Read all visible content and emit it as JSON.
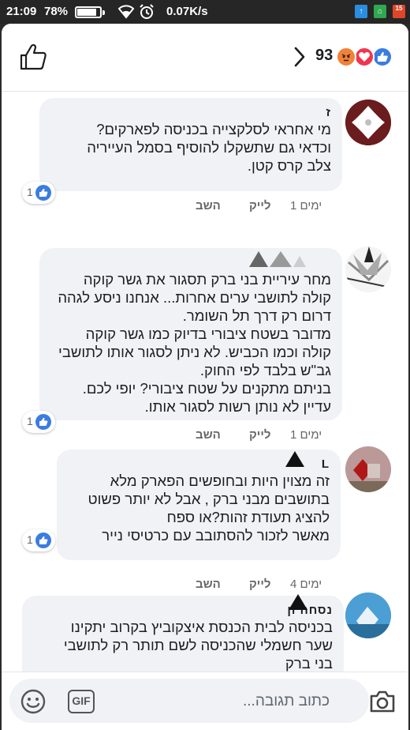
{
  "status_bar": {
    "time": "21:09",
    "battery_percent": "78%",
    "network_speed": "0.07K/s",
    "app_badge_3": "15"
  },
  "header": {
    "reaction_count": "93",
    "reactions": [
      "angry",
      "love",
      "like"
    ]
  },
  "comments": [
    {
      "author": "ז",
      "text": "מי אחראי לסלקצייה בכניסה לפארקים?\nוכדאי גם שתשקלו להוסיף בסמל העייריה\nצלב קרס קטן.",
      "like_count": "1",
      "time": "1 ימים",
      "like_label": "לייק",
      "reply_label": "השב"
    },
    {
      "author": "",
      "text": "מחר עיריית בני ברק תסגור את גשר קוקה\nקולה לתושבי ערים אחרות... אנחנו ניסע לגהה\nדרום רק דרך תל השומר.\nמדובר בשטח ציבורי בדיוק כמו גשר קוקה\nקולה וכמו הכביש. לא ניתן לסגור אותו לתושבי\nגב\"ש בלבד לפי החוק.\nבניתם מתקנים על שטח ציבורי? יופי לכם.\nעדיין לא נותן רשות לסגור אותו.",
      "like_count": "1",
      "time": "1 ימים",
      "like_label": "לייק",
      "reply_label": "השב"
    },
    {
      "author": "L",
      "text": "זה מצוין היות ובחופשים הפארק מלא\nבתושבים מבני ברק , אבל לא יותר פשוט\nלהציג תעודת זהות?או ספח\nמאשר לזכור להסתובב עם כרטיסי נייר",
      "like_count": "1",
      "time": "4 ימים",
      "like_label": "לייק",
      "reply_label": "השב"
    },
    {
      "author": "נסחה ון",
      "text": "בכניסה לבית הכנסת איצקוביץ בקרוב יתקינו\nשער חשמלי שהכניסה לשם תותר רק לתושבי\nבני ברק",
      "like_count": "",
      "time": "",
      "like_label": "",
      "reply_label": ""
    }
  ],
  "composer": {
    "placeholder": "כתוב תגובה...",
    "gif_label": "GIF"
  }
}
